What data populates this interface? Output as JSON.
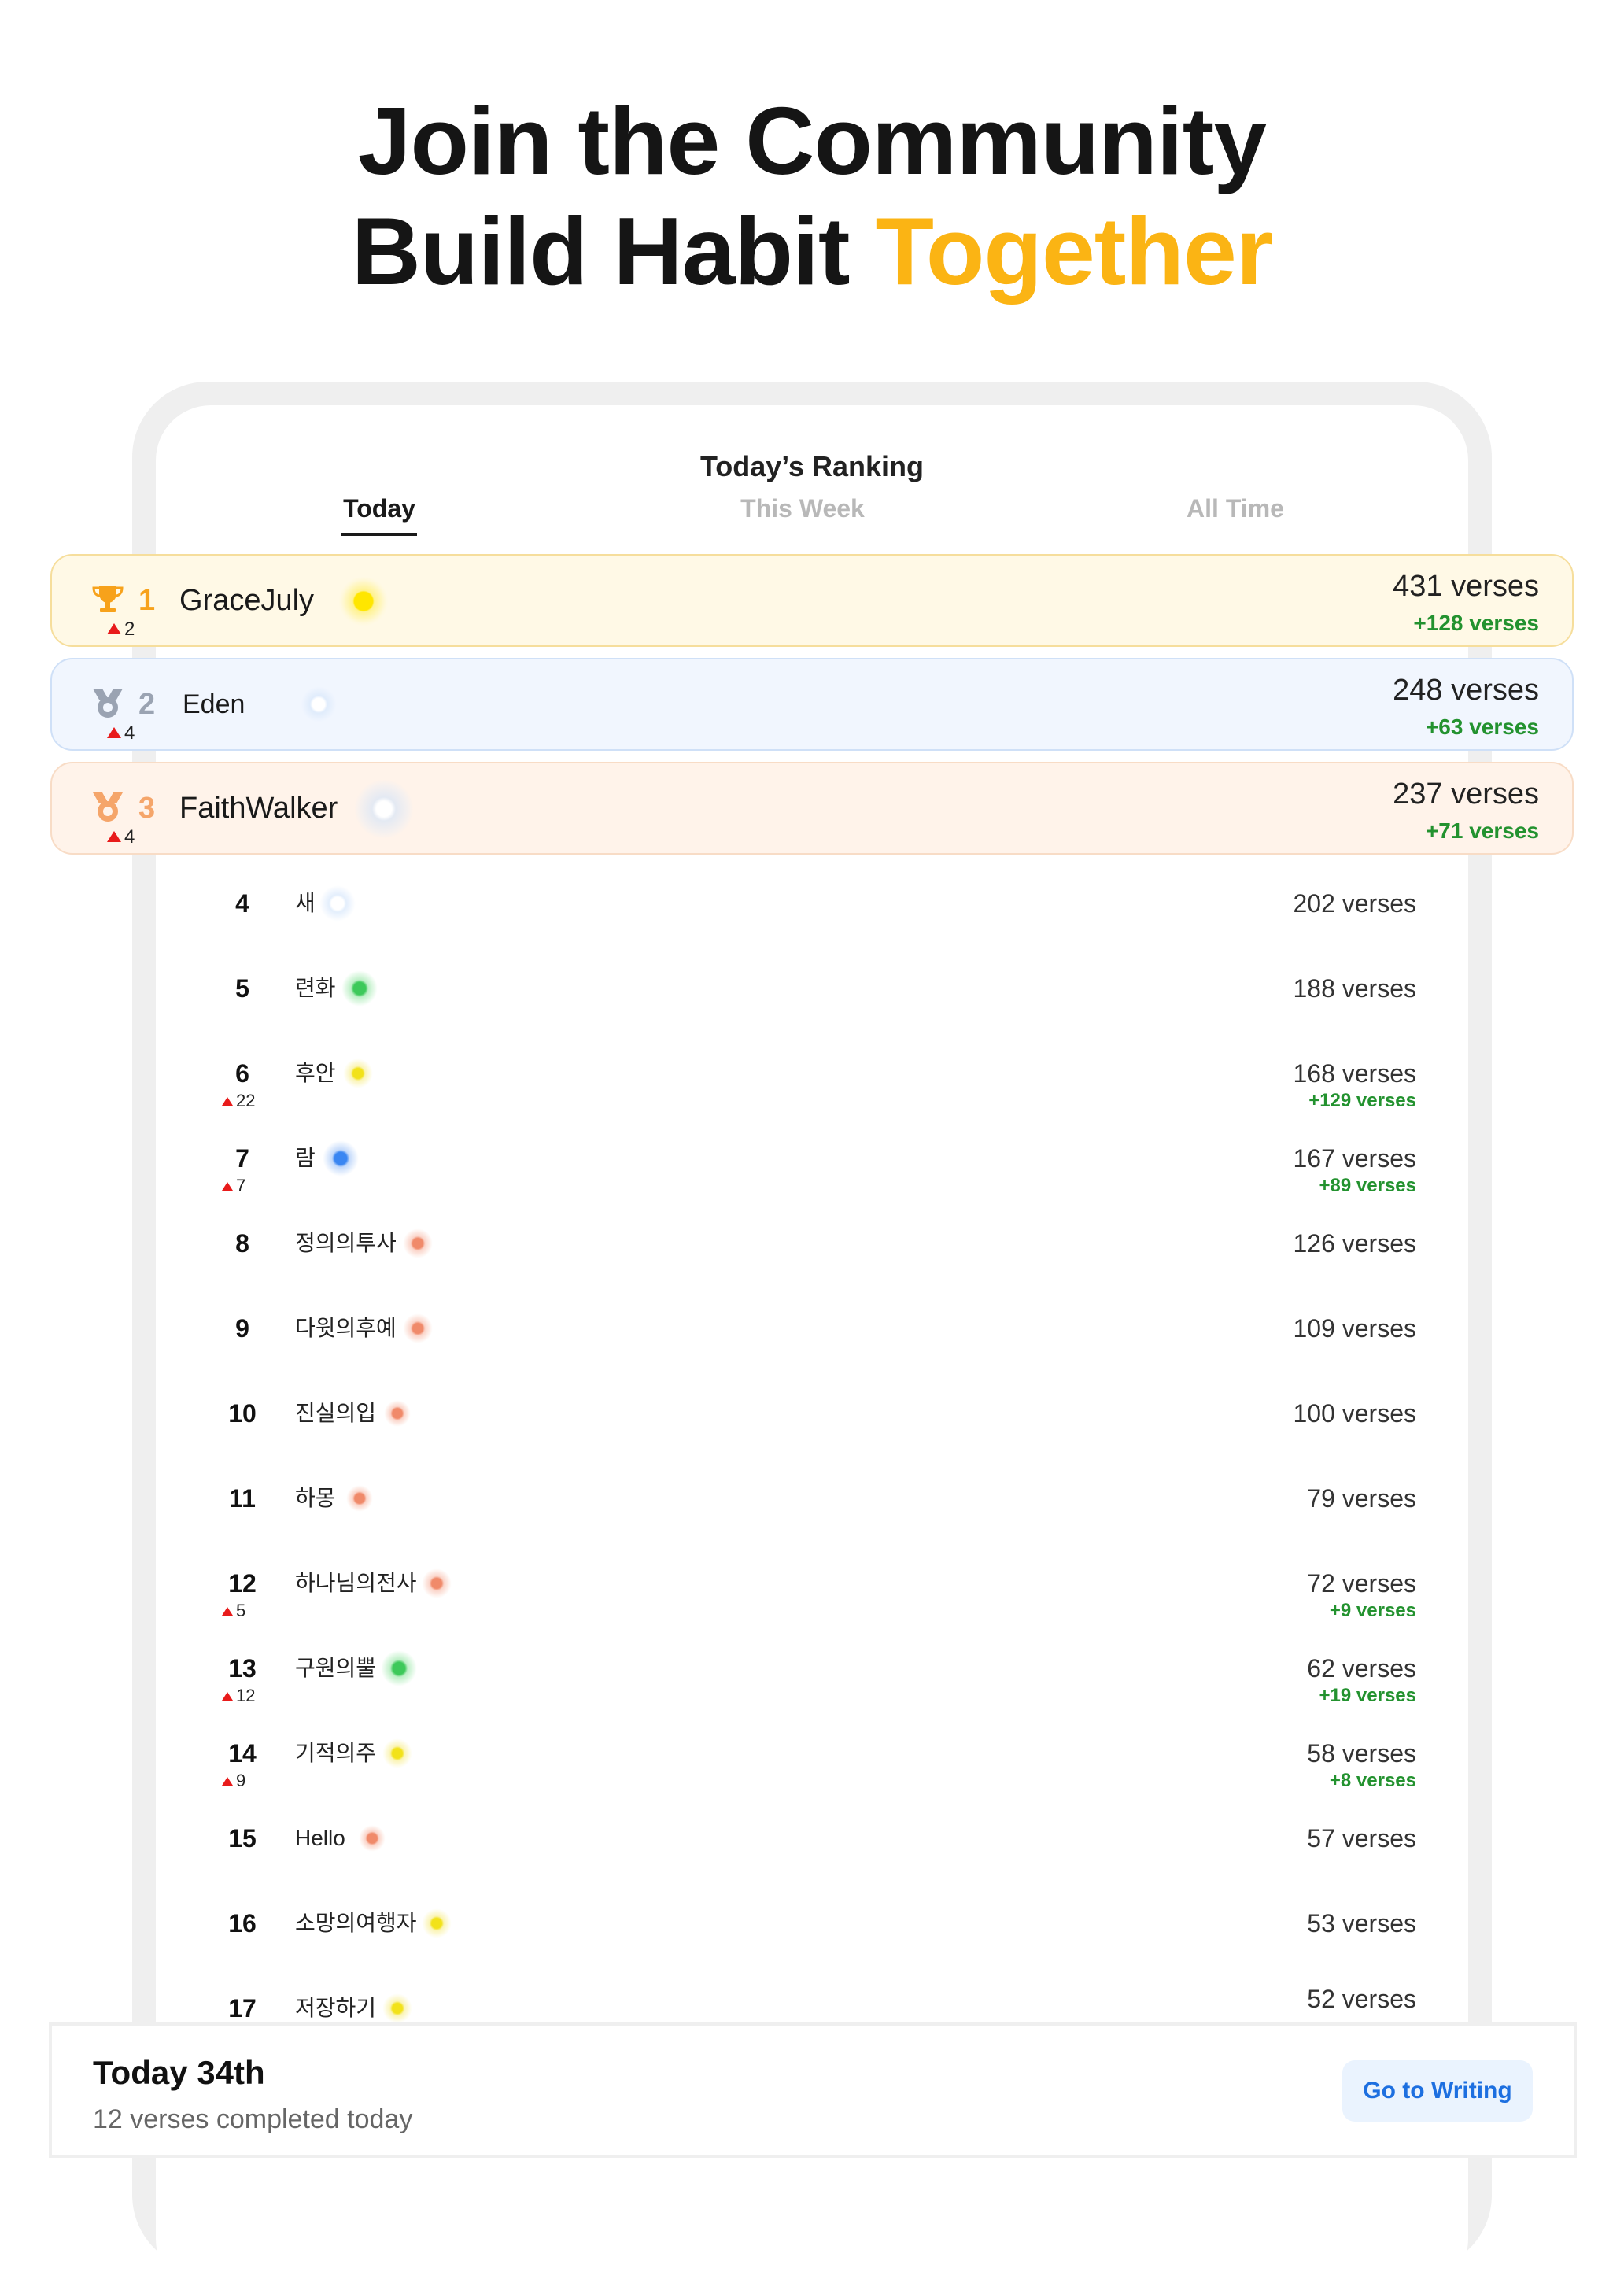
{
  "headline": {
    "line1": "Join the Community",
    "line2_prefix": "Build Habit ",
    "line2_accent": "Together"
  },
  "colors": {
    "accent": "#fbb414",
    "gain_green": "#23922f",
    "rank_up_red": "#e81b1b",
    "button_blue": "#1d6fe0"
  },
  "ranking": {
    "title": "Today’s Ranking",
    "tabs": [
      {
        "label": "Today",
        "active": true
      },
      {
        "label": "This Week",
        "active": false
      },
      {
        "label": "All Time",
        "active": false
      }
    ],
    "podium": [
      {
        "rank": "1",
        "change": "2",
        "name": "GraceJuly",
        "verses": "431 verses",
        "gain": "+128 verses",
        "icon": "trophy-icon",
        "orb": "yellow"
      },
      {
        "rank": "2",
        "change": "4",
        "name": "Eden",
        "verses": "248 verses",
        "gain": "+63 verses",
        "icon": "silver-medal-icon",
        "orb": "white"
      },
      {
        "rank": "3",
        "change": "4",
        "name": "FaithWalker",
        "verses": "237 verses",
        "gain": "+71 verses",
        "icon": "bronze-medal-icon",
        "orb": "white"
      }
    ],
    "rows": [
      {
        "rank": "4",
        "change": "",
        "name": "새",
        "verses": "202 verses",
        "gain": "",
        "orb": "white"
      },
      {
        "rank": "5",
        "change": "",
        "name": "련화",
        "verses": "188 verses",
        "gain": "",
        "orb": "green"
      },
      {
        "rank": "6",
        "change": "22",
        "name": "후안",
        "verses": "168 verses",
        "gain": "+129 verses",
        "orb": "yellow"
      },
      {
        "rank": "7",
        "change": "7",
        "name": "람",
        "verses": "167 verses",
        "gain": "+89 verses",
        "orb": "blue"
      },
      {
        "rank": "8",
        "change": "",
        "name": "정의의투사",
        "verses": "126 verses",
        "gain": "",
        "orb": "orange"
      },
      {
        "rank": "9",
        "change": "",
        "name": "다윗의후예",
        "verses": "109 verses",
        "gain": "",
        "orb": "orange"
      },
      {
        "rank": "10",
        "change": "",
        "name": "진실의입",
        "verses": "100 verses",
        "gain": "",
        "orb": "orange"
      },
      {
        "rank": "11",
        "change": "",
        "name": "하몽",
        "verses": "79 verses",
        "gain": "",
        "orb": "orange"
      },
      {
        "rank": "12",
        "change": "5",
        "name": "하나님의전사",
        "verses": "72 verses",
        "gain": "+9 verses",
        "orb": "orange"
      },
      {
        "rank": "13",
        "change": "12",
        "name": "구원의뿔",
        "verses": "62 verses",
        "gain": "+19 verses",
        "orb": "green"
      },
      {
        "rank": "14",
        "change": "9",
        "name": "기적의주",
        "verses": "58 verses",
        "gain": "+8 verses",
        "orb": "yellow"
      },
      {
        "rank": "15",
        "change": "",
        "name": "Hello",
        "verses": "57 verses",
        "gain": "",
        "orb": "orange"
      },
      {
        "rank": "16",
        "change": "",
        "name": "소망의여행자",
        "verses": "53 verses",
        "gain": "",
        "orb": "yellow"
      },
      {
        "rank": "17",
        "change": "",
        "name": "저장하기",
        "verses": "52 verses",
        "gain": "",
        "orb": "yellow"
      }
    ]
  },
  "footer": {
    "title": "Today 34th",
    "subtitle": "12 verses completed today",
    "button_label": "Go to Writing"
  }
}
